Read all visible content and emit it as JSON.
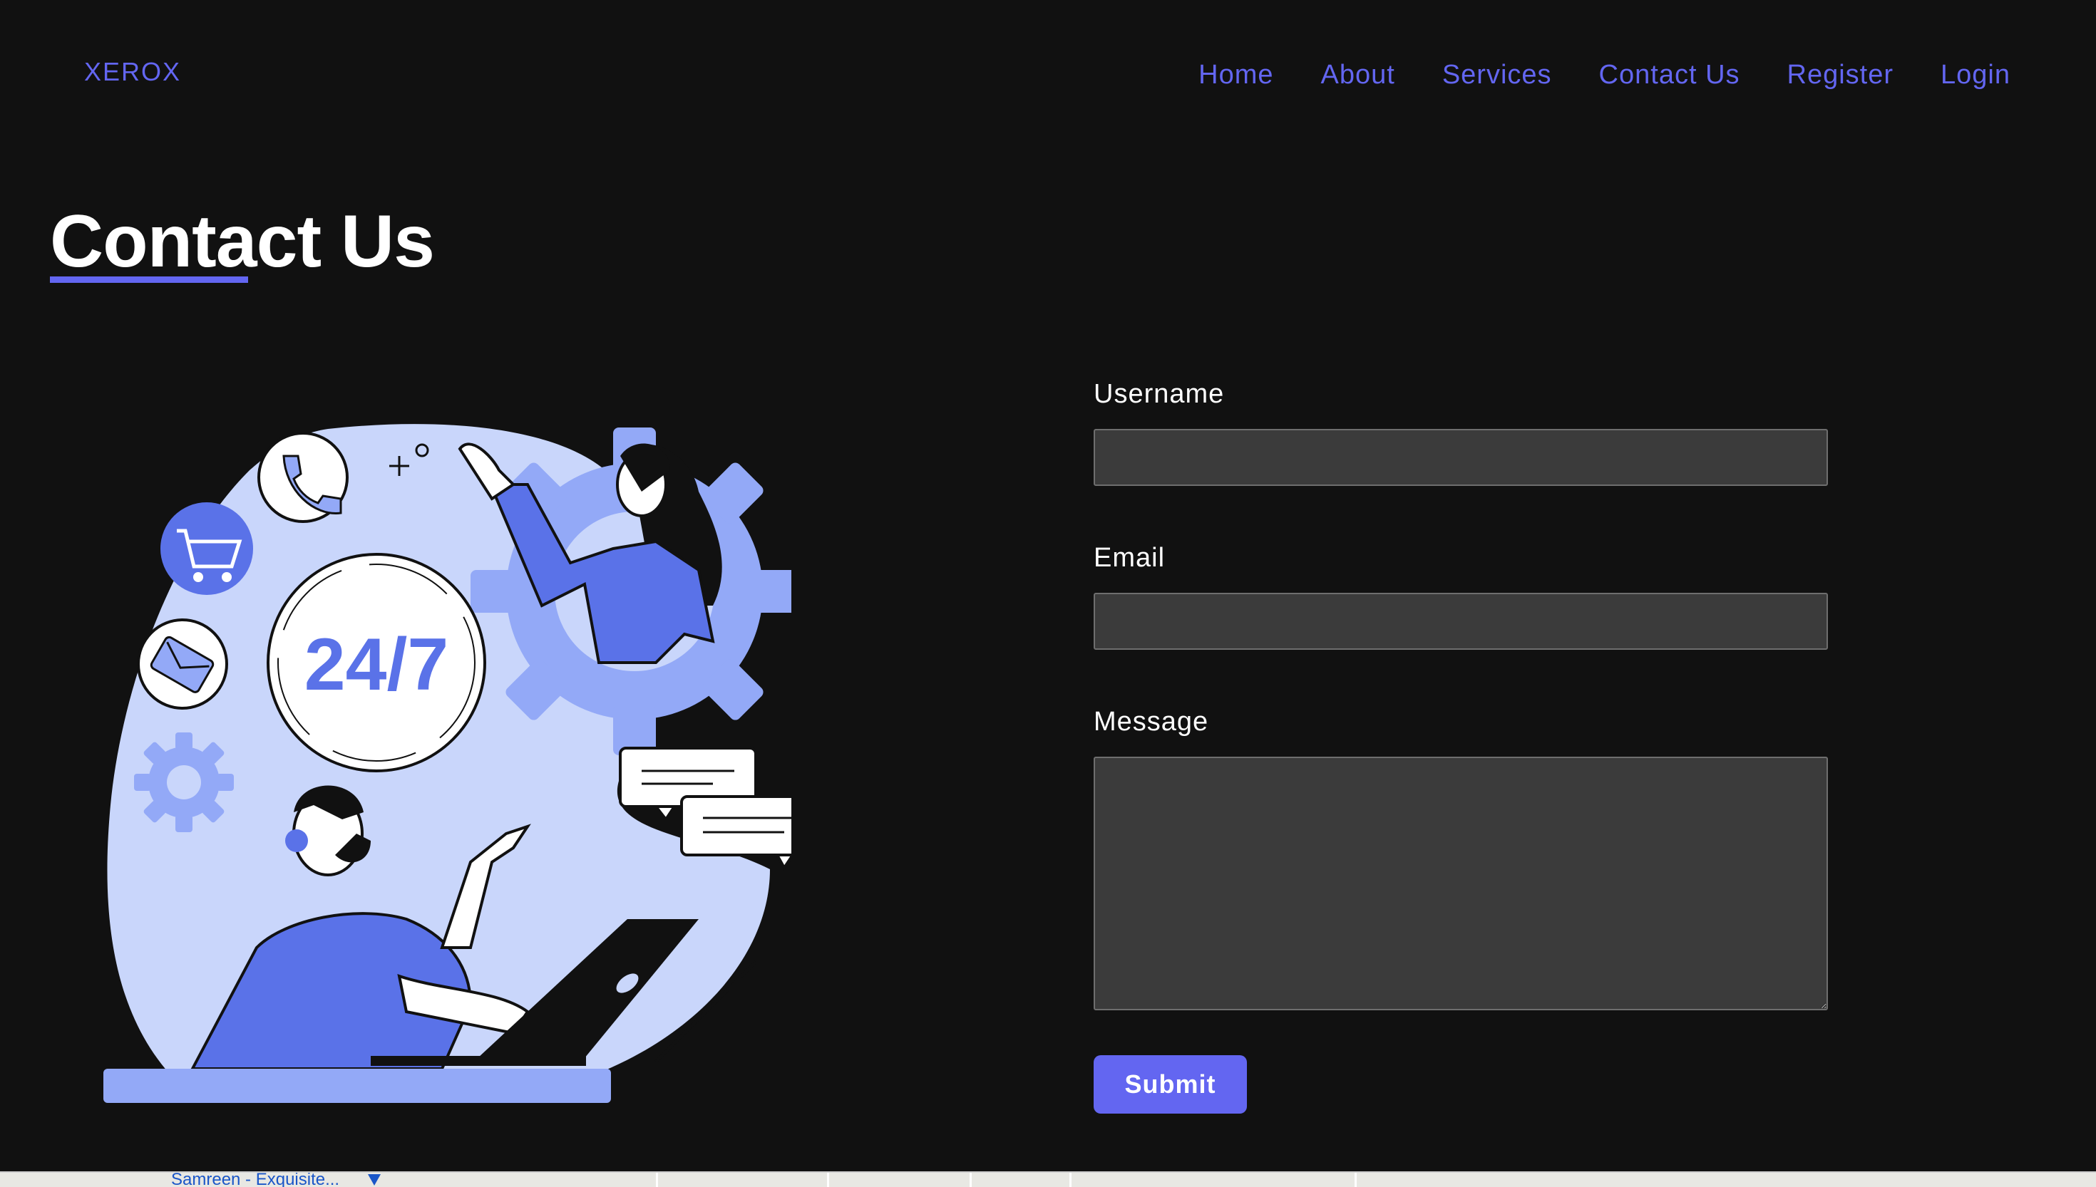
{
  "header": {
    "logo": "XEROX",
    "nav": [
      {
        "label": "Home"
      },
      {
        "label": "About"
      },
      {
        "label": "Services"
      },
      {
        "label": "Contact Us"
      },
      {
        "label": "Register"
      },
      {
        "label": "Login"
      }
    ]
  },
  "page": {
    "title": "Contact Us"
  },
  "illustration": {
    "badge_text": "24/7"
  },
  "form": {
    "username_label": "Username",
    "username_value": "",
    "email_label": "Email",
    "email_value": "",
    "message_label": "Message",
    "message_value": "",
    "submit_label": "Submit"
  },
  "map": {
    "place_label": "Samreen - Exquisite..."
  },
  "colors": {
    "background": "#111111",
    "accent": "#6366f1",
    "input_bg": "#3b3b3b",
    "illustration_light": "#c9d6fb",
    "illustration_mid": "#93a9f7",
    "illustration_dark": "#5a72e8"
  }
}
